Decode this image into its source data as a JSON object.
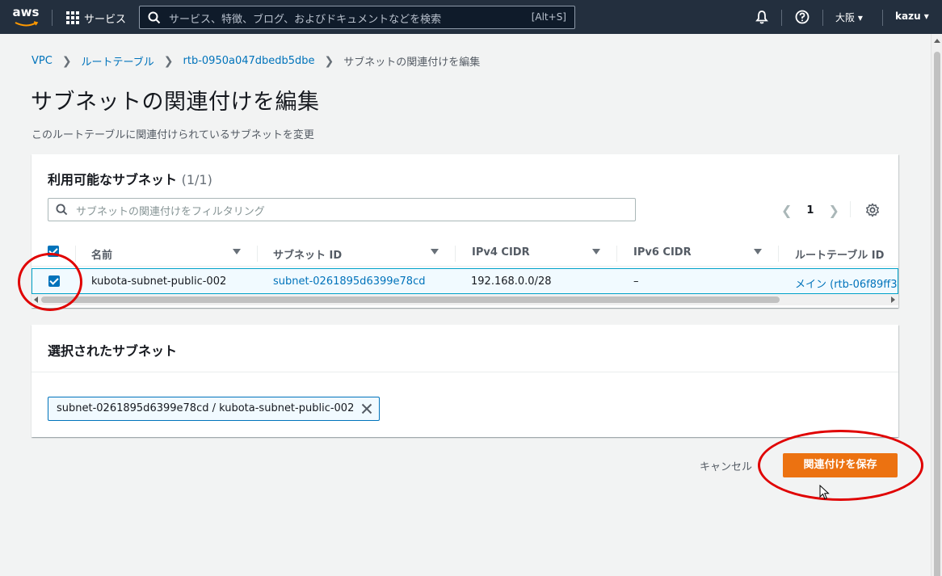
{
  "topnav": {
    "logo_text": "aws",
    "services_label": "サービス",
    "search_placeholder": "サービス、特徴、ブログ、およびドキュメントなどを検索",
    "search_shortcut": "[Alt+S]",
    "region": "大阪 ▾",
    "user": "kazu ▾",
    "icons": [
      "grid-icon",
      "search-icon",
      "bell-icon",
      "help-icon"
    ]
  },
  "breadcrumb": {
    "items": [
      "VPC",
      "ルートテーブル",
      "rtb-0950a047dbedb5dbe",
      "サブネットの関連付けを編集"
    ]
  },
  "page": {
    "title": "サブネットの関連付けを編集",
    "description": "このルートテーブルに関連付けられているサブネットを変更"
  },
  "available": {
    "title": "利用可能なサブネット",
    "count": "(1/1)",
    "filter_placeholder": "サブネットの関連付けをフィルタリング",
    "page": "1",
    "columns": [
      "名前",
      "サブネット ID",
      "IPv4 CIDR",
      "IPv6 CIDR",
      "ルートテーブル ID"
    ],
    "rows": [
      {
        "name": "kubota-subnet-public-002",
        "subnet_id": "subnet-0261895d6399e78cd",
        "ipv4": "192.168.0.0/28",
        "ipv6": "–",
        "route_table": "メイン (rtb-06f89ff3"
      }
    ]
  },
  "selected": {
    "title": "選択されたサブネット",
    "tokens": [
      "subnet-0261895d6399e78cd / kubota-subnet-public-002"
    ]
  },
  "actions": {
    "cancel": "キャンセル",
    "save": "関連付けを保存"
  },
  "colors": {
    "nav_bg": "#232f3e",
    "link": "#0073bb",
    "primary": "#ec7211",
    "annotation": "#e00000"
  }
}
